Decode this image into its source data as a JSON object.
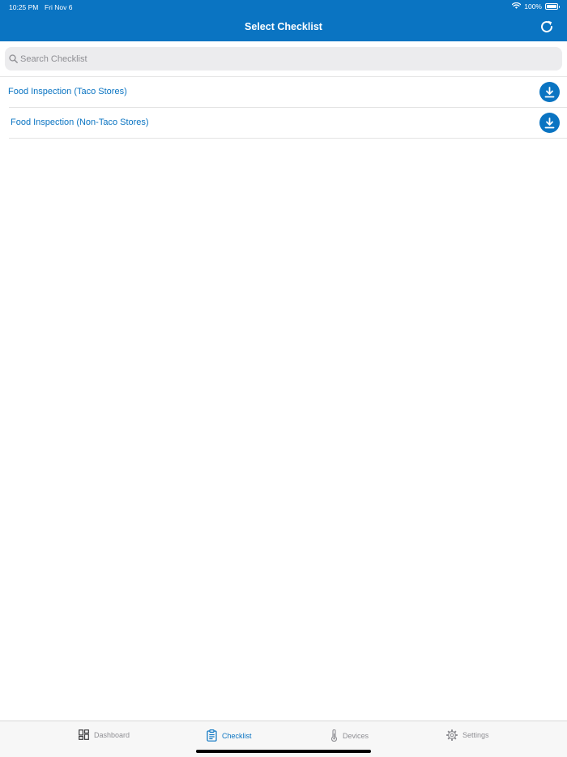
{
  "status_bar": {
    "time": "10:25 PM",
    "date": "Fri Nov 6",
    "battery": "100%"
  },
  "header": {
    "title": "Select Checklist"
  },
  "search": {
    "placeholder": "Search Checklist"
  },
  "checklists": [
    {
      "label": "Food Inspection (Taco Stores)"
    },
    {
      "label": "Food Inspection (Non-Taco Stores)"
    }
  ],
  "tabs": [
    {
      "label": "Dashboard",
      "icon": "dashboard-icon",
      "active": false
    },
    {
      "label": "Checklist",
      "icon": "clipboard-icon",
      "active": true
    },
    {
      "label": "Devices",
      "icon": "thermometer-icon",
      "active": false
    },
    {
      "label": "Settings",
      "icon": "gear-icon",
      "active": false
    }
  ],
  "colors": {
    "accent": "#0a74c2",
    "inactive_tab": "#8e8e93",
    "search_background": "#ececee"
  }
}
